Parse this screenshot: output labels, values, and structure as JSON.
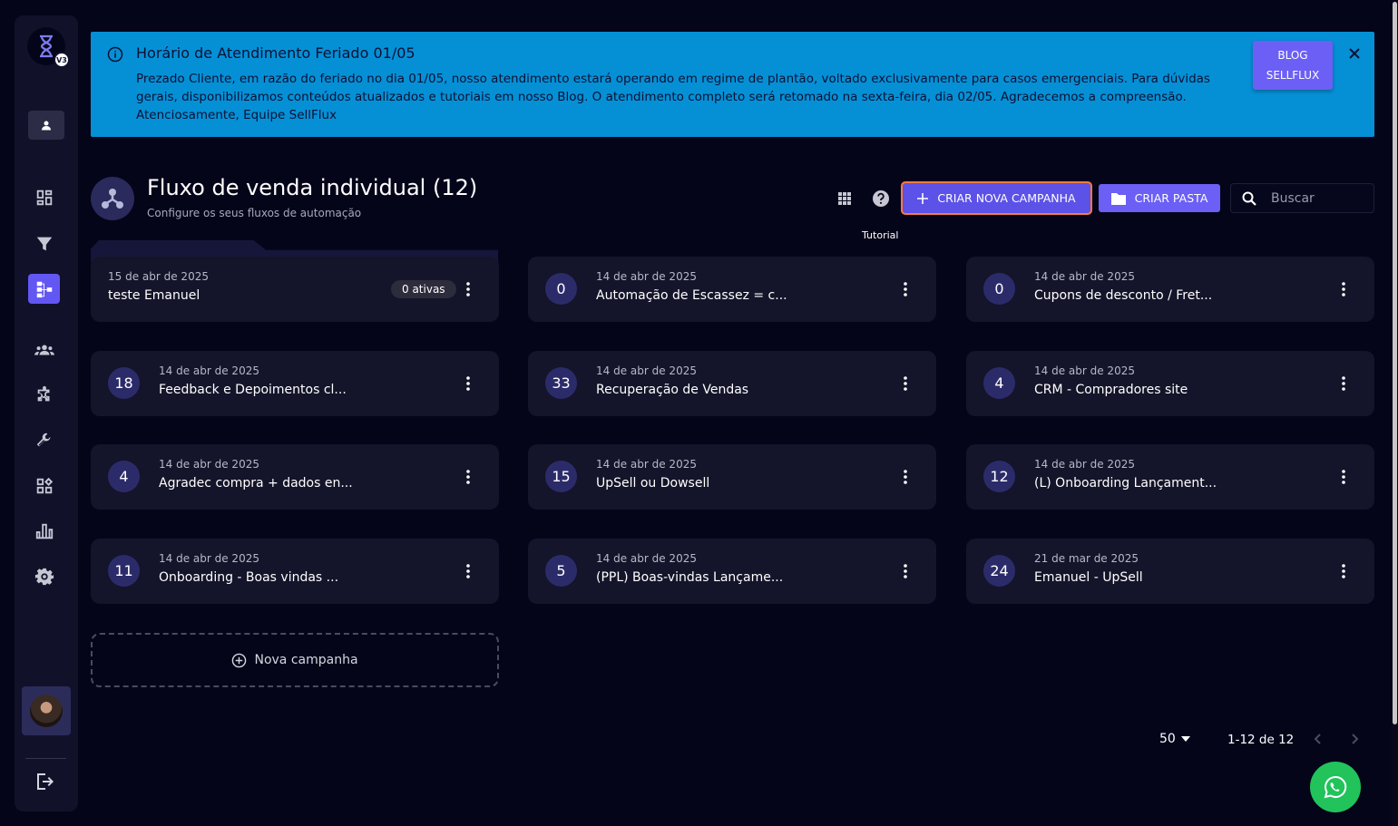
{
  "sidebar": {
    "logo_badge": "V3",
    "nav_items": [
      {
        "name": "dashboard",
        "icon": "dashboard-icon"
      },
      {
        "name": "funnel",
        "icon": "filter-icon"
      },
      {
        "name": "flows",
        "icon": "flow-icon",
        "active": true
      },
      {
        "name": "contacts",
        "icon": "group-icon"
      },
      {
        "name": "integrations",
        "icon": "puzzle-icon"
      },
      {
        "name": "tools",
        "icon": "wrench-icon"
      },
      {
        "name": "widgets",
        "icon": "widgets-icon"
      },
      {
        "name": "reports",
        "icon": "bar-chart-icon"
      },
      {
        "name": "settings",
        "icon": "gear-icon"
      }
    ]
  },
  "banner": {
    "title": "Horário de Atendimento Feriado 01/05",
    "text": "Prezado Cliente, em razão do feriado no dia 01/05, nosso atendimento estará operando em regime de plantão, voltado exclusivamente para casos emergenciais. Para dúvidas gerais, disponibilizamos conteúdos atualizados e tutoriais em nosso Blog. O atendimento completo será retomado na sexta-feira, dia 02/05. Agradecemos a compreensão. Atenciosamente, Equipe SellFlux",
    "button_line1": "BLOG",
    "button_line2": "SELLFLUX"
  },
  "header": {
    "title": "Fluxo de venda individual",
    "count": "(12)",
    "subtitle": "Configure os seus fluxos de automação",
    "tooltip": "Tutorial",
    "create_button": "CRIAR NOVA CAMPANHA",
    "folder_button": "CRIAR PASTA",
    "search_placeholder": "Buscar"
  },
  "cards": [
    {
      "date": "15 de abr de 2025",
      "name": "teste Emanuel",
      "badge": "0 ativas"
    },
    {
      "count": "0",
      "date": "14 de abr de 2025",
      "name": "Automação de Escassez = c..."
    },
    {
      "count": "0",
      "date": "14 de abr de 2025",
      "name": "Cupons de desconto / Fret..."
    },
    {
      "count": "18",
      "date": "14 de abr de 2025",
      "name": "Feedback e Depoimentos cl..."
    },
    {
      "count": "33",
      "date": "14 de abr de 2025",
      "name": "Recuperação de Vendas"
    },
    {
      "count": "4",
      "date": "14 de abr de 2025",
      "name": "CRM - Compradores site"
    },
    {
      "count": "4",
      "date": "14 de abr de 2025",
      "name": "Agradec compra + dados en..."
    },
    {
      "count": "15",
      "date": "14 de abr de 2025",
      "name": "UpSell ou Dowsell"
    },
    {
      "count": "12",
      "date": "14 de abr de 2025",
      "name": "(L) Onboarding Lançament..."
    },
    {
      "count": "11",
      "date": "14 de abr de 2025",
      "name": "Onboarding - Boas vindas ..."
    },
    {
      "count": "5",
      "date": "14 de abr de 2025",
      "name": "(PPL) Boas-vindas Lançame..."
    },
    {
      "count": "24",
      "date": "21 de mar de 2025",
      "name": "Emanuel - UpSell"
    }
  ],
  "new_campaign_label": "Nova campanha",
  "pagination": {
    "page_size": "50",
    "range": "1-12 de 12"
  },
  "colors": {
    "background": "#05051a",
    "card": "#14142a",
    "accent": "#6b5ff5",
    "banner": "#0590d6",
    "whatsapp": "#21c35a"
  }
}
